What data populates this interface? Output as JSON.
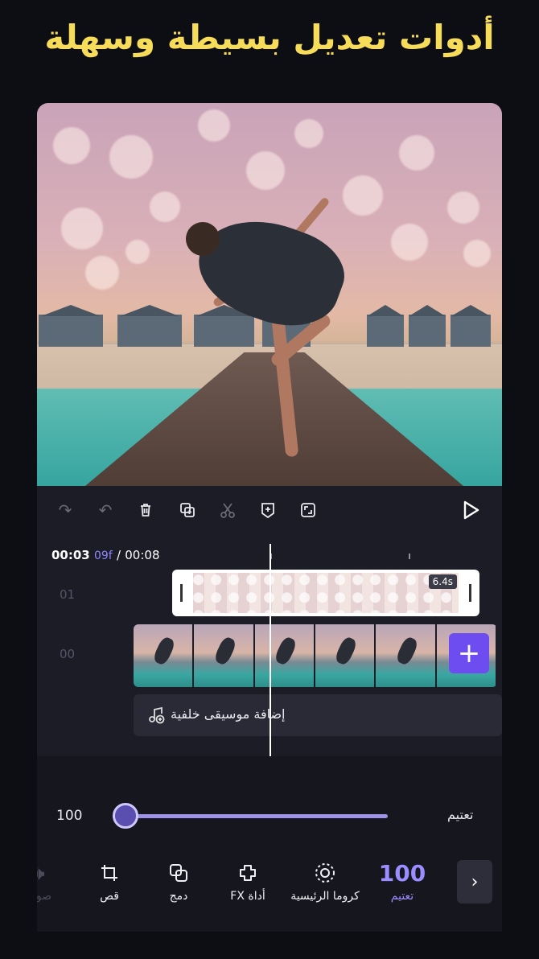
{
  "headline": "أدوات تعديل بسيطة وسهلة",
  "toolbar": {
    "icons": [
      "redo-icon",
      "undo-icon",
      "delete-icon",
      "duplicate-icon",
      "split-icon",
      "add-keyframe-icon",
      "fullscreen-icon",
      "play-icon"
    ]
  },
  "timeline": {
    "current_time": "00:03",
    "current_frames": "09f",
    "separator": "/",
    "total_time": "00:08",
    "track_labels": [
      "01",
      "00"
    ],
    "overlay_duration": "6.4s",
    "add_clip_symbol": "+",
    "add_music_label": "إضافة موسيقى خلفية"
  },
  "adjust": {
    "value": "100",
    "value_fraction": 0.0,
    "label": "تعتيم"
  },
  "tools": [
    {
      "label": "صوت",
      "icon": "volume-icon",
      "state": "faded"
    },
    {
      "label": "قص",
      "icon": "crop-icon",
      "state": "normal"
    },
    {
      "label": "دمج",
      "icon": "blend-icon",
      "state": "normal"
    },
    {
      "label": "أداة FX",
      "icon": "fx-icon",
      "state": "normal"
    },
    {
      "label": "كروما الرئيسية",
      "icon": "chroma-key-icon",
      "state": "normal"
    },
    {
      "label": "تعتيم",
      "value": "100",
      "state": "active"
    }
  ],
  "scroll_next_symbol": "›",
  "colors": {
    "headline": "#f7dc5a",
    "accent": "#6d4cf0",
    "accent_light": "#9b8cff",
    "background": "#0d0d14"
  }
}
